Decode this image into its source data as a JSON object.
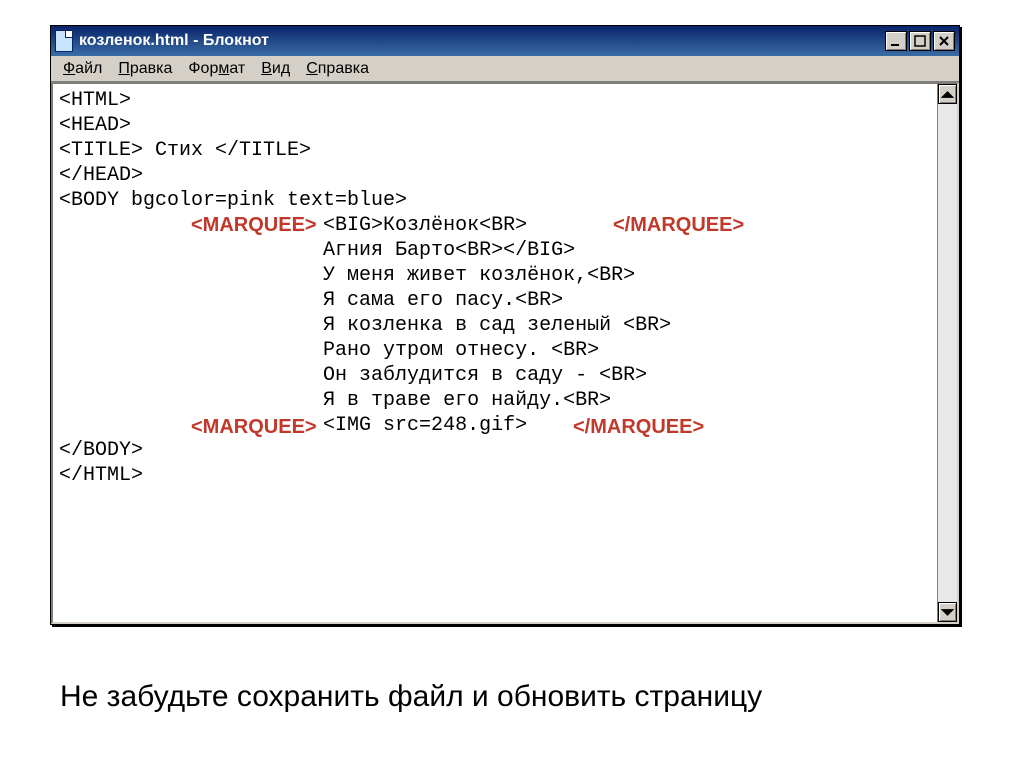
{
  "window": {
    "title": "козленок.html - Блокнот"
  },
  "menus": {
    "file": {
      "label": "Файл",
      "ul_index": 0
    },
    "edit": {
      "label": "Правка",
      "ul_index": 0
    },
    "format": {
      "label": "Формат",
      "ul_index": 3
    },
    "view": {
      "label": "Вид",
      "ul_index": 0
    },
    "help": {
      "label": "Справка",
      "ul_index": 0
    }
  },
  "editor": {
    "lines": [
      "<HTML>",
      "<HEAD>",
      "<TITLE> Стих </TITLE>",
      "</HEAD>",
      "<BODY bgcolor=pink text=blue>",
      "                      <BIG>Козлёнок<BR>",
      "                      Агния Барто<BR></BIG>",
      "                      У меня живет козлёнок,<BR>",
      "                      Я сама его пасу.<BR>",
      "                      Я козленка в сад зеленый <BR>",
      "                      Рано утром отнесу. <BR>",
      "                      Он заблудится в саду - <BR>",
      "                      Я в траве его найду.<BR>",
      "                      <IMG src=248.gif>",
      "</BODY>",
      "</HTML>"
    ]
  },
  "overlays": {
    "marquee_open_1": "<MARQUEE>",
    "marquee_close_1": "</MARQUEE>",
    "marquee_open_2": "<MARQUEE>",
    "marquee_close_2": "</MARQUEE>"
  },
  "caption": "Не забудьте сохранить файл и обновить страницу"
}
